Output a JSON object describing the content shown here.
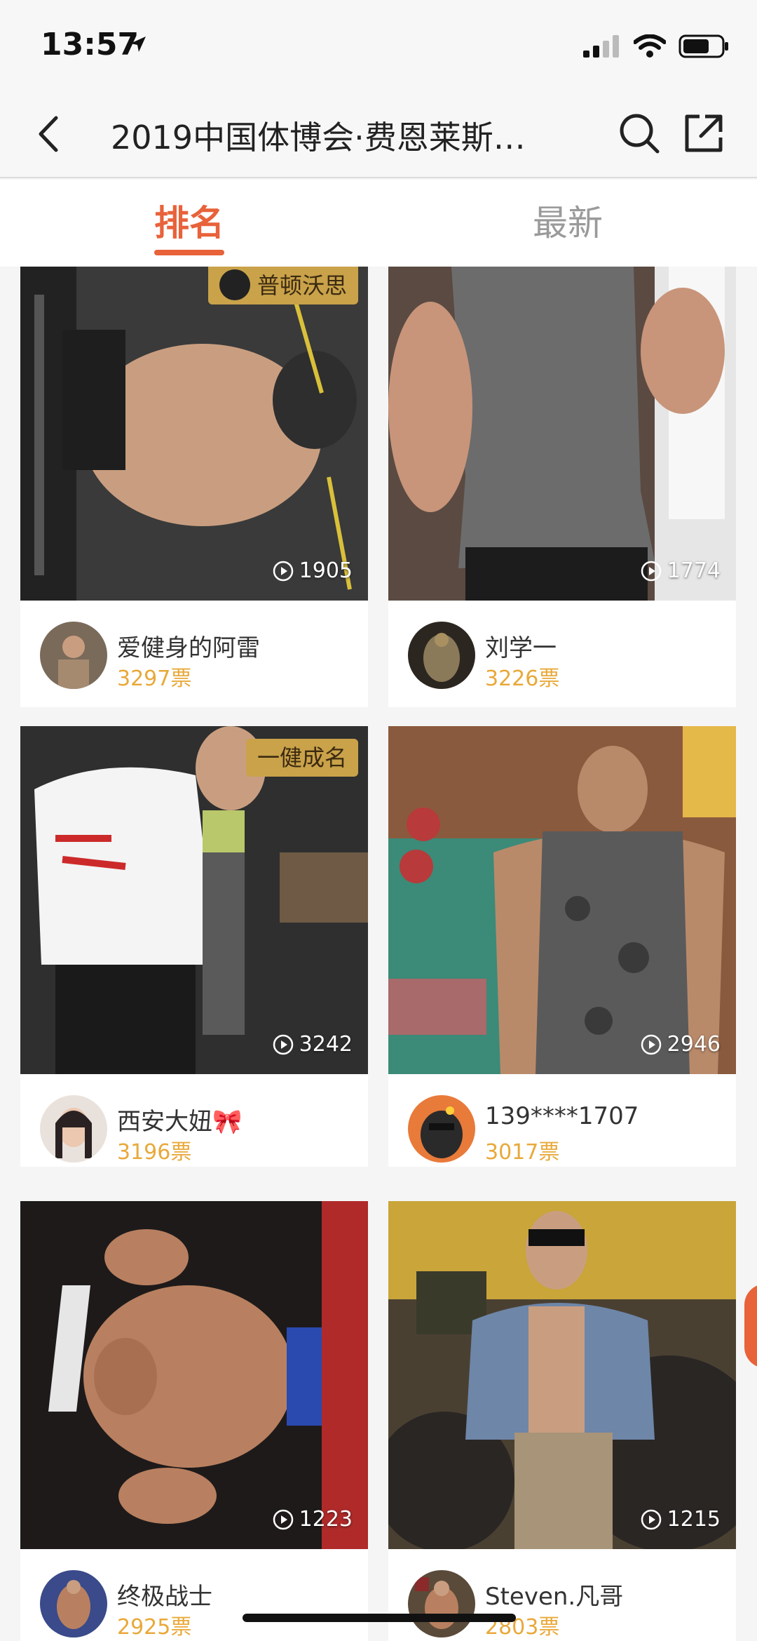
{
  "status": {
    "time": "13:57"
  },
  "nav": {
    "title": "2019中国体博会·费恩莱斯…"
  },
  "tabs": [
    {
      "label": "排名",
      "active": true
    },
    {
      "label": "最新",
      "active": false
    }
  ],
  "cards": [
    {
      "badge": "普顿沃思",
      "plays": "1905",
      "name": "爱健身的阿雷",
      "votes": "3297票"
    },
    {
      "badge": "",
      "plays": "1774",
      "name": "刘学一",
      "votes": "3226票"
    },
    {
      "badge": "一健成名",
      "plays": "3242",
      "name": "西安大妞🎀",
      "votes": "3196票"
    },
    {
      "badge": "",
      "plays": "2946",
      "name": "139****1707",
      "votes": "3017票"
    },
    {
      "badge": "",
      "plays": "1223",
      "name": "终极战士",
      "votes": "2925票"
    },
    {
      "badge": "",
      "plays": "1215",
      "name": "Steven.凡哥",
      "votes": "2803票"
    }
  ],
  "colors": {
    "accent": "#e8623a",
    "votes": "#e8a93a",
    "badge": "#c9a24a"
  }
}
